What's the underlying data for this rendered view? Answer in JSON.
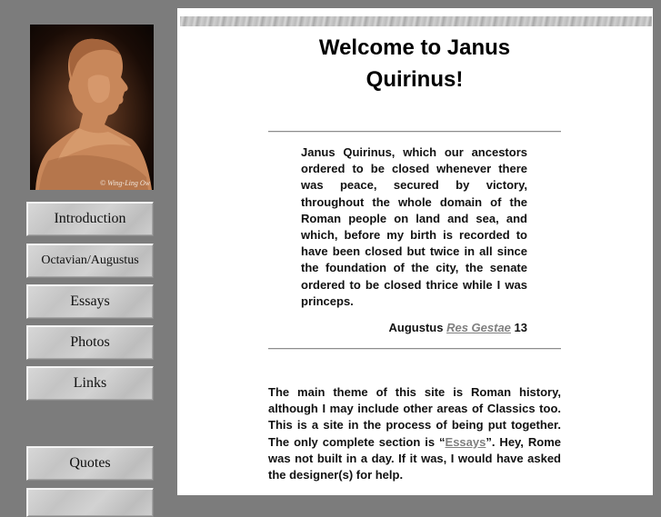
{
  "sidebar": {
    "portrait_credit": "© Wing-Ling Ow",
    "nav": [
      {
        "label": "Introduction"
      },
      {
        "label": "Octavian/Augustus"
      },
      {
        "label": "Essays"
      },
      {
        "label": "Photos"
      },
      {
        "label": "Links"
      },
      {
        "label": "Quotes"
      }
    ]
  },
  "main": {
    "title_line1": "Welcome to Janus",
    "title_line2": "Quirinus!",
    "quote": {
      "text": "Janus Quirinus, which our ancestors ordered to be closed whenever there was peace, secured by victory, throughout the whole domain of the Roman people on land and sea, and which, before my birth is recorded to have been closed but twice in all since the foundation of the city, the senate ordered to be closed thrice while I was princeps.",
      "author": "Augustus",
      "work": "Res Gestae",
      "section": "13"
    },
    "intro": {
      "before_link": "The main theme of this site is Roman history, although I may include other areas of Classics too. This is a site in the process of being put together. The only complete section is “",
      "link": "Essays",
      "after_link": "”. Hey, Rome was not built in a day. If it was, I would have asked the designer(s) for help."
    }
  },
  "colors": {
    "page_background": "#7c7c7c",
    "content_background": "#ffffff",
    "link": "#808080",
    "button_face": "#cfcfcf"
  }
}
